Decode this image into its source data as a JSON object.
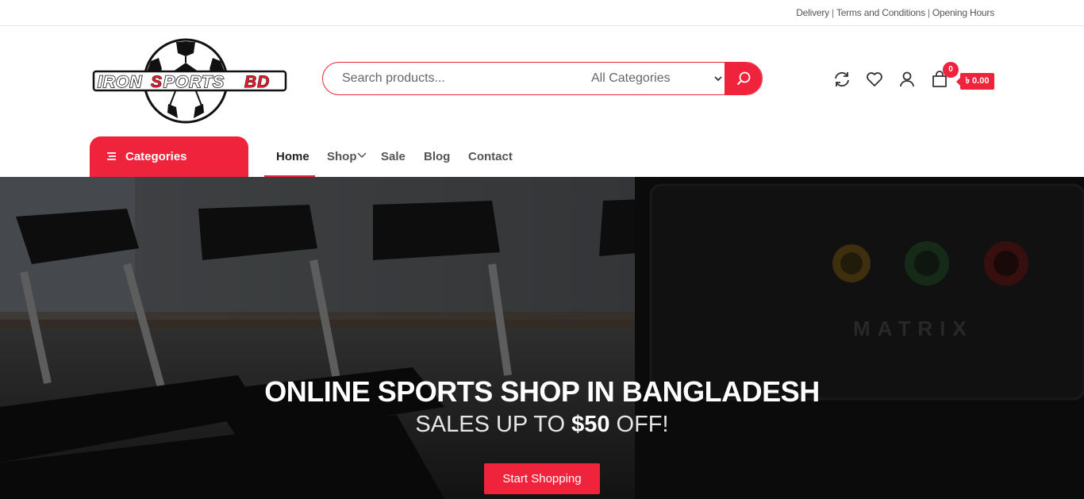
{
  "topbar": {
    "links": [
      "Delivery",
      "Terms and Conditions",
      "Opening Hours"
    ]
  },
  "logo": {
    "text": "IRONSPORTSBD"
  },
  "search": {
    "placeholder": "Search products...",
    "category_selected": "All Categories"
  },
  "header_icons": [
    "refresh-icon",
    "heart-icon",
    "user-icon",
    "cart-icon"
  ],
  "cart": {
    "count": "0",
    "amount": "৳ 0.00"
  },
  "nav": {
    "categories_label": "Categories",
    "items": [
      "Home",
      "Shop",
      "Sale",
      "Blog",
      "Contact"
    ],
    "active": "Home"
  },
  "hero": {
    "title": "ONLINE SPORTS SHOP IN BANGLADESH",
    "subtitle_pre": "SALES UP TO ",
    "subtitle_bold": "$50",
    "subtitle_post": " OFF!",
    "cta": "Start Shopping"
  },
  "colors": {
    "accent": "#f0233c",
    "text": "#555555"
  }
}
